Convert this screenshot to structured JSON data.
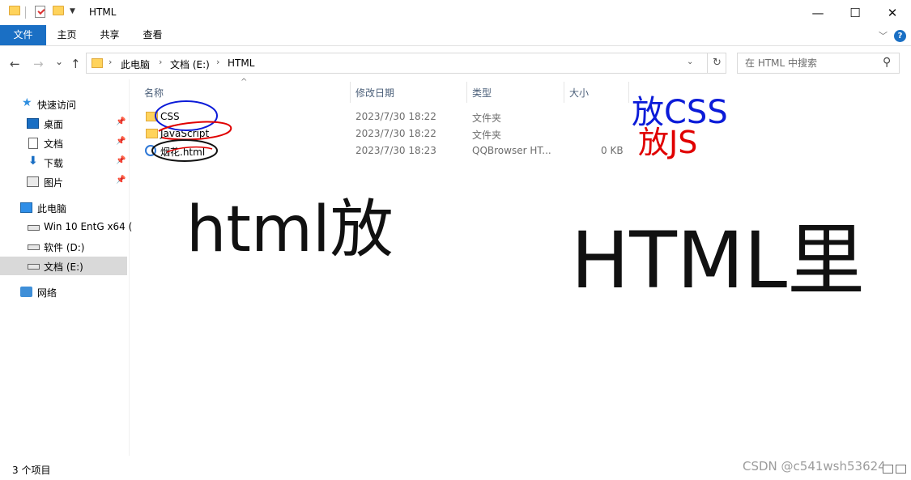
{
  "window": {
    "title": "HTML",
    "controls": {
      "minimize": "—",
      "maximize": "☐",
      "close": "✕"
    }
  },
  "ribbon": {
    "tabs": [
      "文件",
      "主页",
      "共享",
      "查看"
    ],
    "chevron": "﹀",
    "help": "?"
  },
  "navigation": {
    "back": "←",
    "forward": "→",
    "recent": "⌄",
    "up": "↑",
    "breadcrumb": [
      "此电脑",
      "文档 (E:)",
      "HTML"
    ],
    "search_placeholder": "在 HTML 中搜索"
  },
  "sidebar": {
    "quick_access": "快速访问",
    "quick_items": [
      {
        "label": "桌面",
        "icon": "desktop-icon"
      },
      {
        "label": "文档",
        "icon": "document-icon"
      },
      {
        "label": "下载",
        "icon": "download-icon"
      },
      {
        "label": "图片",
        "icon": "pictures-icon"
      }
    ],
    "this_pc": "此电脑",
    "drives": [
      {
        "label": "Win 10 EntG x64 (",
        "icon": "system-drive-icon"
      },
      {
        "label": "软件 (D:)",
        "icon": "drive-icon"
      },
      {
        "label": "文档 (E:)",
        "icon": "drive-icon",
        "selected": true
      }
    ],
    "network": "网络"
  },
  "file_list": {
    "columns": [
      "名称",
      "修改日期",
      "类型",
      "大小"
    ],
    "rows": [
      {
        "name": "CSS",
        "date": "2023/7/30 18:22",
        "type": "文件夹",
        "size": "",
        "icon": "folder-icon"
      },
      {
        "name": "JavaScript",
        "date": "2023/7/30 18:22",
        "type": "文件夹",
        "size": "",
        "icon": "folder-icon"
      },
      {
        "name": "烟花.html",
        "date": "2023/7/30 18:23",
        "type": "QQBrowser HT...",
        "size": "0 KB",
        "icon": "html-file-icon"
      }
    ]
  },
  "annotations": {
    "html_here": "html放",
    "html_in": "HTML里",
    "css_note": "放CSS",
    "js_note": "放JS"
  },
  "status": {
    "item_count": "3 个项目",
    "watermark": "CSDN @c541wsh53624"
  },
  "colors": {
    "file_tab": "#1a6fc4",
    "selected_nav": "#d9d9d9",
    "ink_black": "#000000",
    "ink_blue": "#0b1bd8",
    "ink_red": "#e00000"
  }
}
